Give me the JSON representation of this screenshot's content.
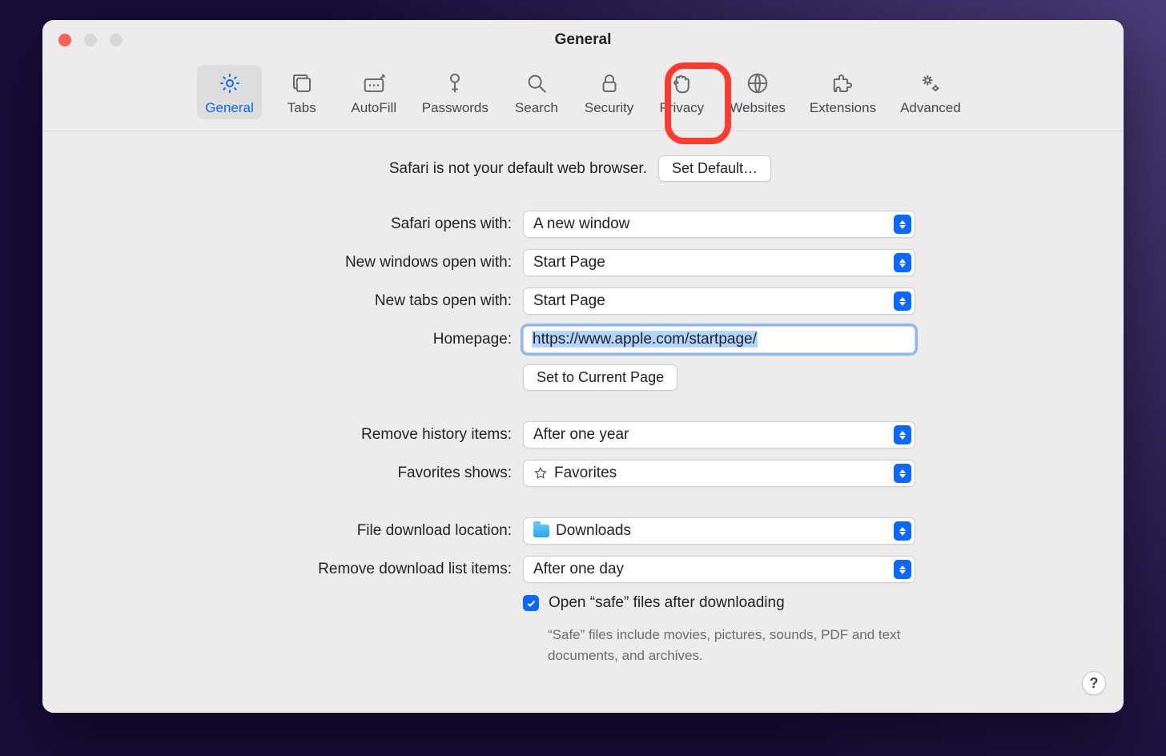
{
  "window": {
    "title": "General"
  },
  "tabs": {
    "general": "General",
    "tabs": "Tabs",
    "autofill": "AutoFill",
    "passwords": "Passwords",
    "search": "Search",
    "security": "Security",
    "privacy": "Privacy",
    "websites": "Websites",
    "extensions": "Extensions",
    "advanced": "Advanced"
  },
  "default_browser": {
    "notice": "Safari is not your default web browser.",
    "button": "Set Default…"
  },
  "form": {
    "opens_with": {
      "label": "Safari opens with:",
      "value": "A new window"
    },
    "new_windows": {
      "label": "New windows open with:",
      "value": "Start Page"
    },
    "new_tabs": {
      "label": "New tabs open with:",
      "value": "Start Page"
    },
    "homepage": {
      "label": "Homepage:",
      "value": "https://www.apple.com/startpage/"
    },
    "set_current": "Set to Current Page",
    "remove_history": {
      "label": "Remove history items:",
      "value": "After one year"
    },
    "favorites": {
      "label": "Favorites shows:",
      "value": "Favorites"
    },
    "download_loc": {
      "label": "File download location:",
      "value": "Downloads"
    },
    "remove_downloads": {
      "label": "Remove download list items:",
      "value": "After one day"
    },
    "safe_files": {
      "label": "Open “safe” files after downloading",
      "sub": "“Safe” files include movies, pictures, sounds, PDF and text documents, and archives."
    }
  },
  "help": "?"
}
